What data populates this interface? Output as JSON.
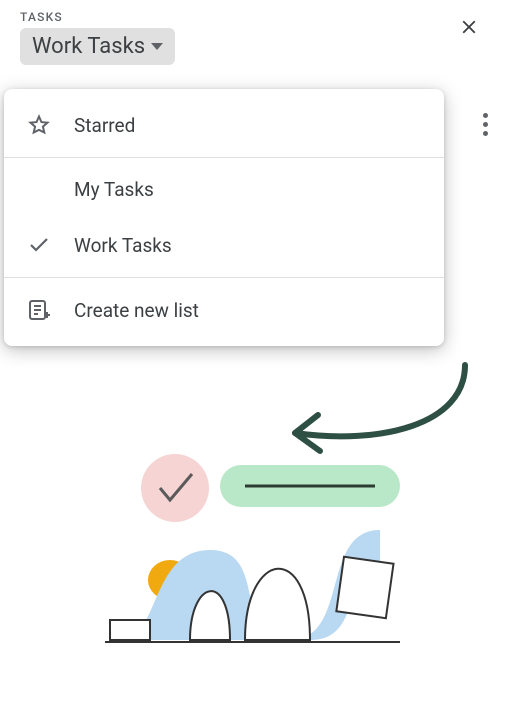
{
  "header": {
    "label": "TASKS",
    "selected_list": "Work Tasks"
  },
  "menu": {
    "starred_label": "Starred",
    "lists": [
      {
        "label": "My Tasks",
        "selected": false
      },
      {
        "label": "Work Tasks",
        "selected": true
      }
    ],
    "create_label": "Create new list"
  }
}
